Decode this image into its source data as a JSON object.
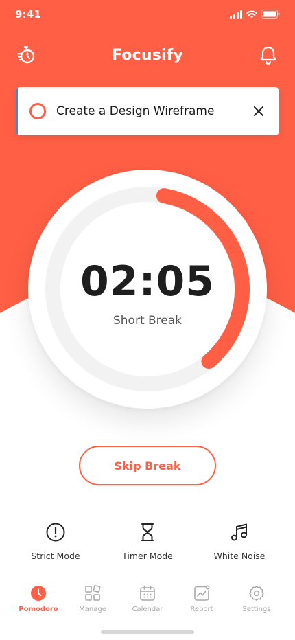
{
  "colors": {
    "accent": "#ff5f45",
    "task_stripe": "#3a8bd6",
    "track": "#f2f2f2",
    "text_dark": "#1e1e1e",
    "tab_inactive": "#a8a8a8"
  },
  "status_bar": {
    "time": "9:41",
    "icons": [
      "signal-icon",
      "wifi-icon",
      "battery-icon"
    ]
  },
  "header": {
    "title": "Focusify",
    "left_icon": "stopwatch-icon",
    "right_icon": "bell-icon"
  },
  "task": {
    "title": "Create a Design Wireframe",
    "check_icon": "circle-checkbox-icon",
    "close_icon": "close-icon"
  },
  "timer": {
    "time": "02:05",
    "label": "Short Break",
    "progress": 0.36
  },
  "skip_button": {
    "label": "Skip Break"
  },
  "modes": [
    {
      "label": "Strict Mode",
      "icon": "alert-circle-icon"
    },
    {
      "label": "Timer Mode",
      "icon": "hourglass-icon"
    },
    {
      "label": "White Noise",
      "icon": "music-note-icon"
    }
  ],
  "tabs": [
    {
      "label": "Pomodoro",
      "icon": "clock-icon",
      "active": true
    },
    {
      "label": "Manage",
      "icon": "grid-icon",
      "active": false
    },
    {
      "label": "Calendar",
      "icon": "calendar-icon",
      "active": false
    },
    {
      "label": "Report",
      "icon": "chart-icon",
      "active": false
    },
    {
      "label": "Settings",
      "icon": "gear-icon",
      "active": false
    }
  ]
}
